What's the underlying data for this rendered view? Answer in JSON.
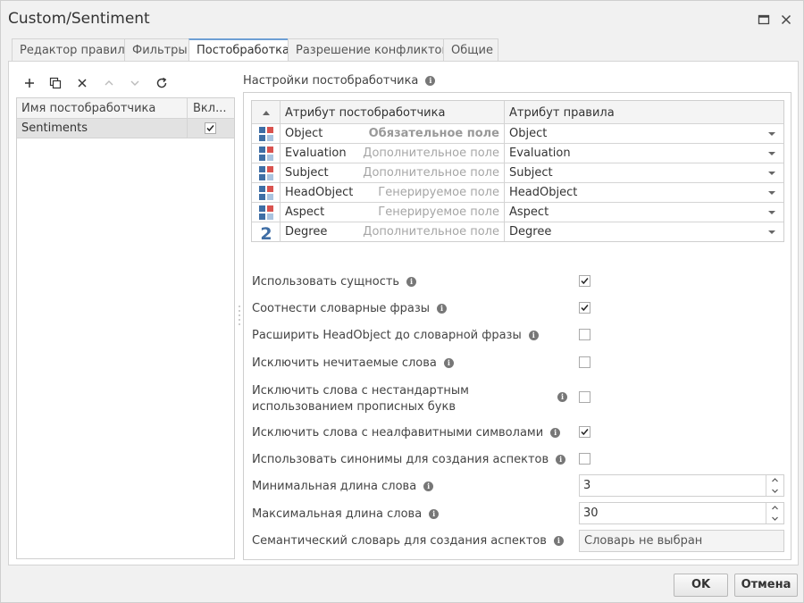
{
  "window": {
    "title": "Custom/Sentiment"
  },
  "tabs": [
    {
      "label": "Редактор правил"
    },
    {
      "label": "Фильтры"
    },
    {
      "label": "Постобработка"
    },
    {
      "label": "Разрешение конфликтов"
    },
    {
      "label": "Общие"
    }
  ],
  "active_tab": "Постобработка",
  "postprocessors": {
    "columns": [
      "Имя постобработчика",
      "Вкл..."
    ],
    "rows": [
      {
        "name": "Sentiments",
        "enabled": true
      }
    ]
  },
  "settings": {
    "title": "Настройки постобработчика",
    "attr_columns": [
      "Атрибут постобработчика",
      "Атрибут правила"
    ],
    "attributes": [
      {
        "icon": "entity-grid-icon",
        "name": "Object",
        "kind": "Обязательное поле",
        "value": "Object"
      },
      {
        "icon": "entity-grid-icon",
        "name": "Evaluation",
        "kind": "Дополнительное поле",
        "value": "Evaluation"
      },
      {
        "icon": "entity-grid-icon",
        "name": "Subject",
        "kind": "Дополнительное поле",
        "value": "Subject"
      },
      {
        "icon": "entity-grid-icon",
        "name": "HeadObject",
        "kind": "Генерируемое поле",
        "value": "HeadObject"
      },
      {
        "icon": "entity-grid-icon",
        "name": "Aspect",
        "kind": "Генерируемое поле",
        "value": "Aspect"
      },
      {
        "icon": "number-icon",
        "icon_text": "2",
        "name": "Degree",
        "kind": "Дополнительное поле",
        "value": "Degree"
      }
    ],
    "options": [
      {
        "label": "Использовать сущность",
        "checked": true
      },
      {
        "label": "Соотнести словарные фразы",
        "checked": true
      },
      {
        "label": "Расширить HeadObject до словарной фразы",
        "checked": false
      },
      {
        "label": "Исключить нечитаемые слова",
        "checked": false
      },
      {
        "label_line1": "Исключить слова с нестандартным",
        "label_line2": "использованием прописных букв",
        "checked": false
      },
      {
        "label": "Исключить слова с неалфавитными символами",
        "checked": true
      },
      {
        "label": "Использовать синонимы для создания аспектов",
        "checked": false
      }
    ],
    "min_word_length": {
      "label": "Минимальная длина слова",
      "value": "3"
    },
    "max_word_length": {
      "label": "Максимальная длина слова",
      "value": "30"
    },
    "semantic_dict": {
      "label": "Семантический словарь для создания аспектов",
      "value": "Словарь не выбран"
    }
  },
  "buttons": {
    "ok": "OK",
    "cancel": "Отмена"
  },
  "colors": {
    "accent": "#6e9fd4",
    "icon_red": "#d9534f",
    "icon_blue": "#3f6ea5",
    "icon_light": "#aac4e0"
  }
}
